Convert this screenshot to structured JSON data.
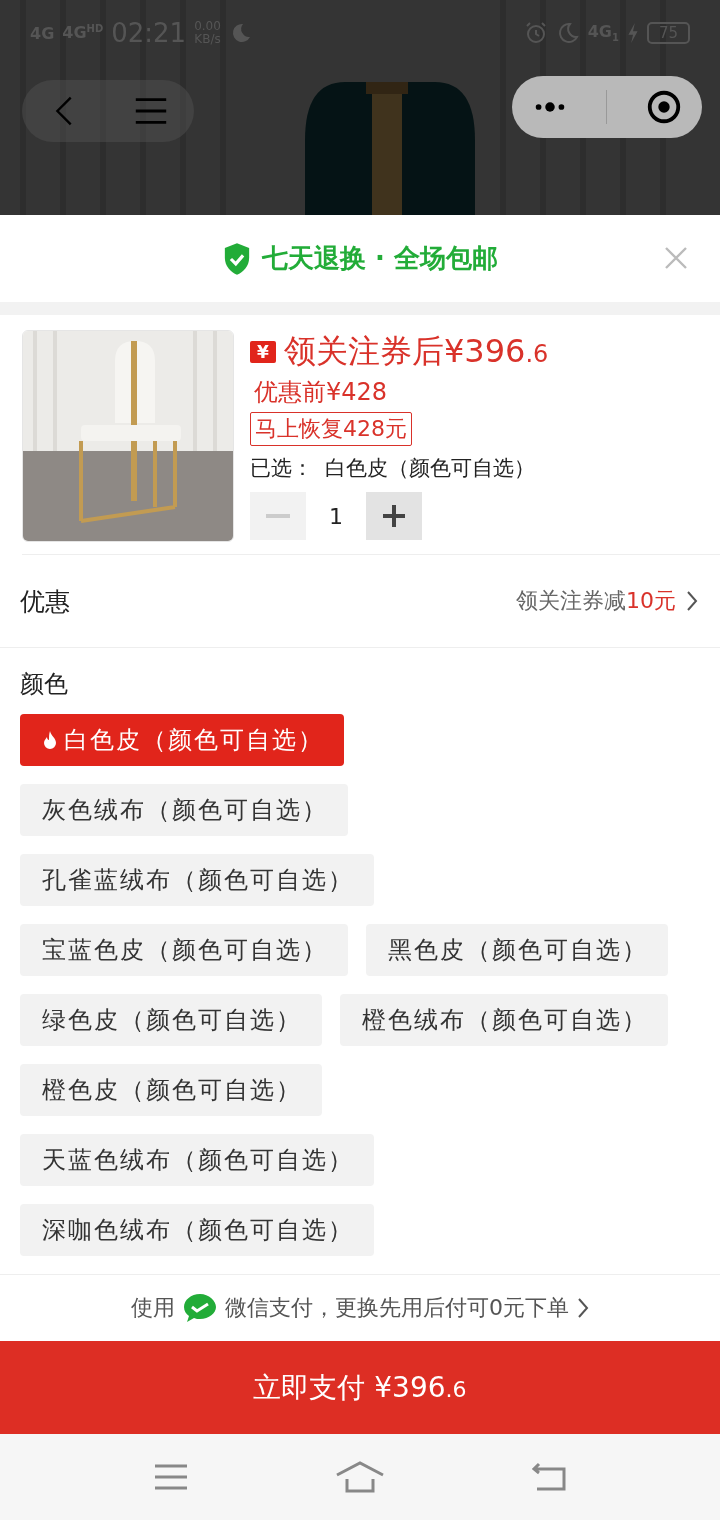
{
  "status_bar": {
    "network_1": "4G",
    "network_2": "4G",
    "network_2_badge": "HD",
    "time": "02:21",
    "speed": "0.00",
    "speed_unit": "KB/s",
    "network_3": "4G",
    "network_3_badge": "1",
    "battery": "75"
  },
  "banner": {
    "text": "七天退换 · 全场包邮"
  },
  "product": {
    "coupon_icon": "¥",
    "price_label": "领关注券后",
    "price_main": "¥396",
    "price_decimal": ".6",
    "original_price": "优惠前¥428",
    "restore_tag": "马上恢复428元",
    "selected_label": "已选：",
    "selected_value": "白色皮（颜色可自选）",
    "quantity": "1",
    "decrease_disabled": true
  },
  "discount": {
    "label": "优惠",
    "text": "领关注券减",
    "amount": "10元"
  },
  "color": {
    "title": "颜色",
    "options": [
      {
        "label": "白色皮（颜色可自选）",
        "selected": true,
        "hot": true
      },
      {
        "label": "灰色绒布（颜色可自选）",
        "selected": false,
        "hot": false
      },
      {
        "label": "孔雀蓝绒布（颜色可自选）",
        "selected": false,
        "hot": false
      },
      {
        "label": "宝蓝色皮（颜色可自选）",
        "selected": false,
        "hot": false
      },
      {
        "label": "黑色皮（颜色可自选）",
        "selected": false,
        "hot": false
      },
      {
        "label": "绿色皮（颜色可自选）",
        "selected": false,
        "hot": false
      },
      {
        "label": "橙色绒布（颜色可自选）",
        "selected": false,
        "hot": false
      },
      {
        "label": "橙色皮（颜色可自选）",
        "selected": false,
        "hot": false
      },
      {
        "label": "天蓝色绒布（颜色可自选）",
        "selected": false,
        "hot": false
      },
      {
        "label": "深咖色绒布（颜色可自选）",
        "selected": false,
        "hot": false
      }
    ]
  },
  "payment_note": {
    "prefix": "使用",
    "method": "微信支付，更换先用后付可0元下单"
  },
  "pay_button": {
    "label": "立即支付",
    "price_main": "¥396",
    "price_decimal": ".6"
  }
}
